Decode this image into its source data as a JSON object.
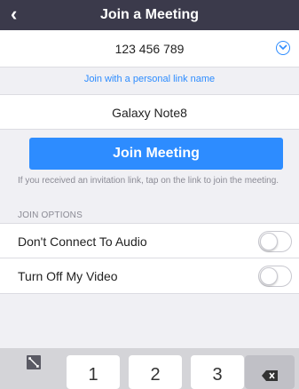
{
  "header": {
    "title": "Join a Meeting",
    "back_icon": "chevron-left-icon"
  },
  "meeting": {
    "id": "123 456 789",
    "dropdown_icon": "chevron-down-icon"
  },
  "personal_link_label": "Join with a personal link name",
  "name_field": {
    "value": "Galaxy Note8"
  },
  "join_button_label": "Join Meeting",
  "hint": "If you received an invitation link, tap on the link to join the meeting.",
  "options": {
    "section_title": "JOIN OPTIONS",
    "items": [
      {
        "label": "Don't Connect To Audio",
        "enabled": false
      },
      {
        "label": "Turn Off My Video",
        "enabled": false
      }
    ]
  },
  "keyboard": {
    "expand_icon": "expand-icon",
    "keys": [
      "1",
      "2",
      "3"
    ],
    "delete_icon": "backspace-icon"
  },
  "colors": {
    "accent": "#2d8cff",
    "header_bg": "#3b3a4b",
    "page_bg": "#f0f0f4"
  }
}
